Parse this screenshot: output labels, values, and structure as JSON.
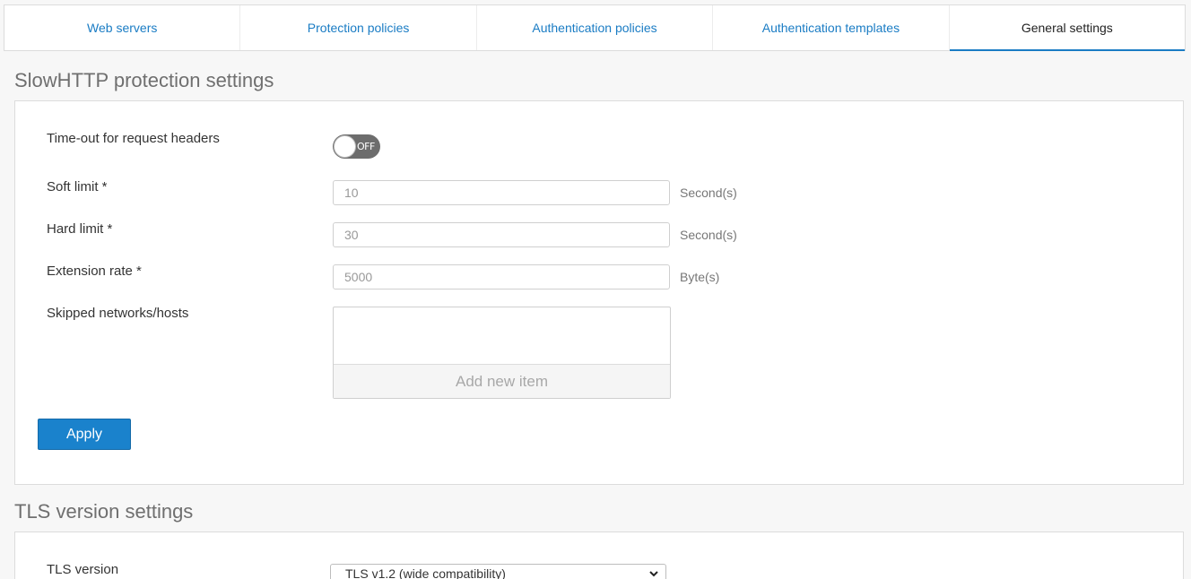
{
  "tabs": [
    {
      "label": "Web servers"
    },
    {
      "label": "Protection policies"
    },
    {
      "label": "Authentication policies"
    },
    {
      "label": "Authentication templates"
    },
    {
      "label": "General settings",
      "active": true
    }
  ],
  "slowhttp": {
    "title": "SlowHTTP protection settings",
    "timeout_label": "Time-out for request headers",
    "timeout_toggle": "OFF",
    "soft_limit_label": "Soft limit *",
    "soft_limit_value": "10",
    "soft_limit_unit": "Second(s)",
    "hard_limit_label": "Hard limit *",
    "hard_limit_value": "30",
    "hard_limit_unit": "Second(s)",
    "extension_rate_label": "Extension rate *",
    "extension_rate_value": "5000",
    "extension_rate_unit": "Byte(s)",
    "skipped_label": "Skipped networks/hosts",
    "add_item_label": "Add new item",
    "apply_label": "Apply"
  },
  "tls": {
    "title": "TLS version settings",
    "version_label": "TLS version",
    "version_value": "TLS v1.2 (wide compatibility)"
  },
  "icons": {
    "dropdown": "chevron-down-icon"
  },
  "colors": {
    "accent": "#1a7cc4",
    "button": "#1a82cc"
  }
}
